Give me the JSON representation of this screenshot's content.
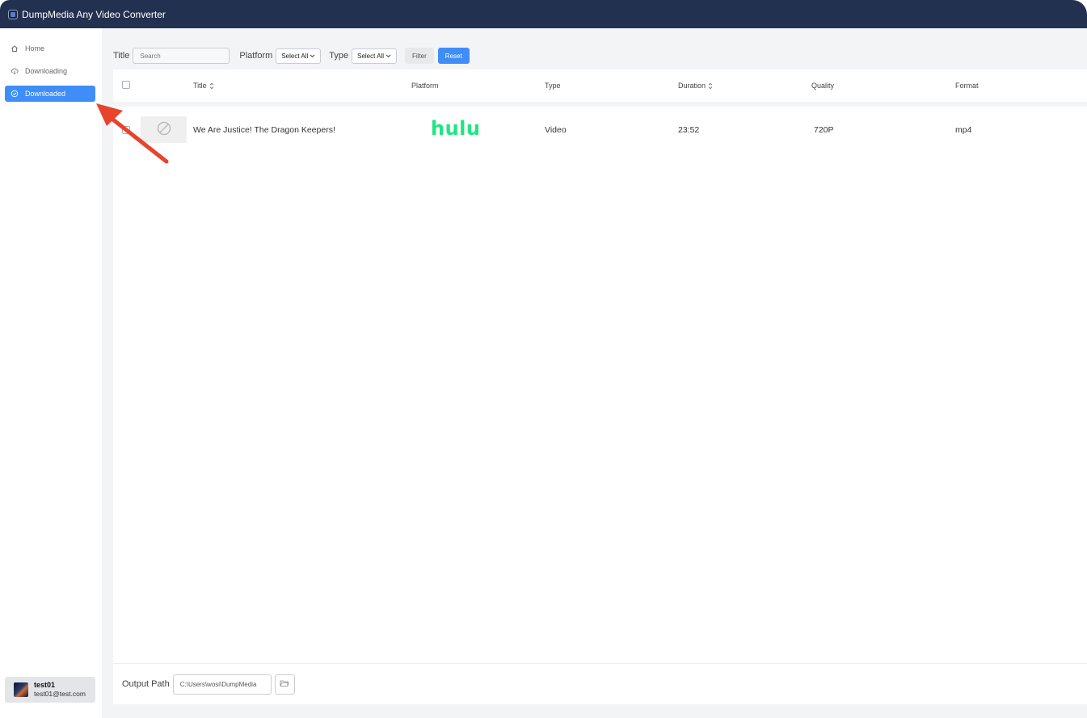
{
  "window": {
    "title": "DumpMedia Any Video Converter"
  },
  "sidebar": {
    "items": [
      {
        "label": "Home",
        "icon": "home-icon",
        "active": false
      },
      {
        "label": "Downloading",
        "icon": "cloud-download-icon",
        "active": false
      },
      {
        "label": "Downloaded",
        "icon": "check-circle-icon",
        "active": true
      }
    ],
    "user": {
      "name": "test01",
      "email": "test01@test.com"
    }
  },
  "filters": {
    "title_label": "Title",
    "search_placeholder": "Search",
    "platform_label": "Platform",
    "platform_value": "Select All",
    "type_label": "Type",
    "type_value": "Select All",
    "filter_button": "Filter",
    "reset_button": "Reset"
  },
  "table": {
    "columns": [
      "Title",
      "Platform",
      "Type",
      "Duration",
      "Quality",
      "Format"
    ],
    "rows": [
      {
        "title": "We Are Justice! The Dragon Keepers!",
        "platform": "hulu",
        "type": "Video",
        "duration": "23:52",
        "quality": "720P",
        "format": "mp4"
      }
    ]
  },
  "footer": {
    "output_label": "Output Path",
    "output_path": "C:\\Users\\wosi\\DumpMedia"
  },
  "colors": {
    "titlebar": "#233150",
    "accent": "#3f8ef7",
    "hulu": "#1ce783",
    "annotation_arrow": "#e8432c"
  }
}
